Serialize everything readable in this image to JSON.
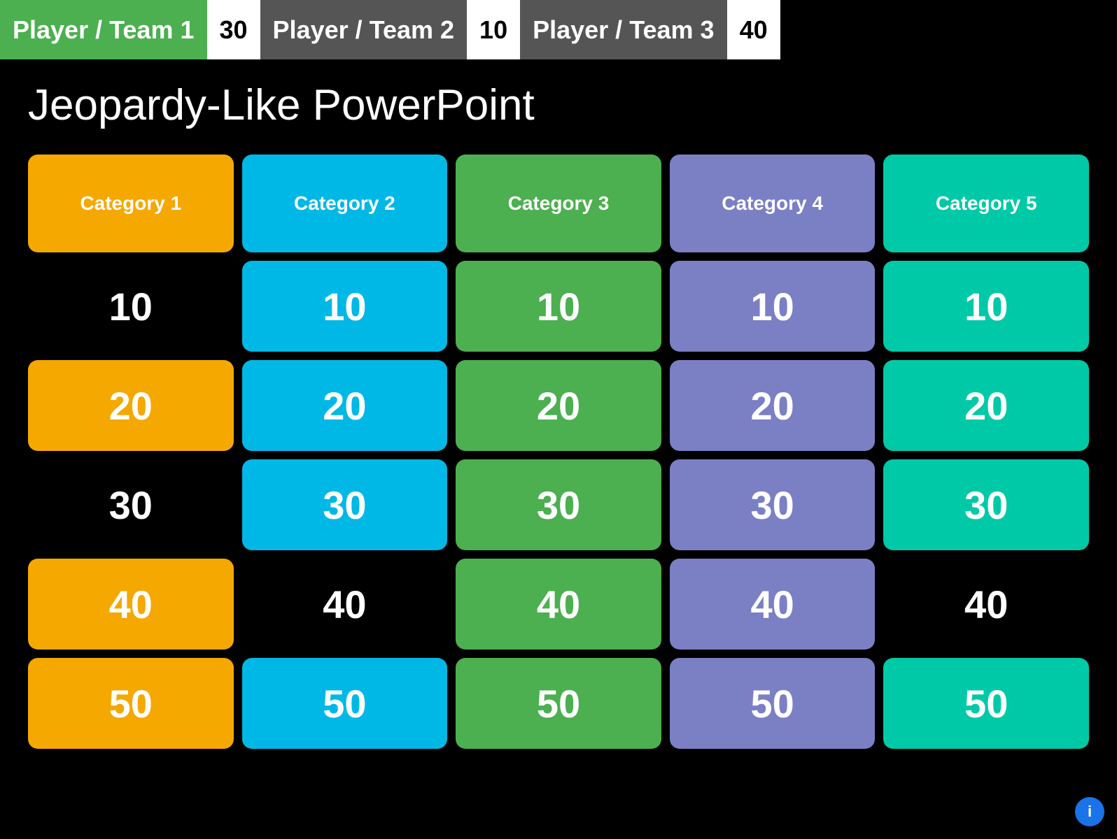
{
  "scorebar": {
    "teams": [
      {
        "name": "Player / Team 1",
        "score": "30",
        "nameClass": "team-1-name"
      },
      {
        "name": "Player / Team 2",
        "score": "10",
        "nameClass": "team-2-name"
      },
      {
        "name": "Player / Team 3",
        "score": "40",
        "nameClass": "team-3-name"
      }
    ]
  },
  "title": "Jeopardy-Like PowerPoint",
  "categories": [
    {
      "label": "Category 1",
      "colorClass": "cat-1",
      "colClass": "col-1"
    },
    {
      "label": "Category 2",
      "colorClass": "cat-2",
      "colClass": "col-2"
    },
    {
      "label": "Category 3",
      "colorClass": "cat-3",
      "colClass": "col-3"
    },
    {
      "label": "Category 4",
      "colorClass": "cat-4",
      "colClass": "col-4"
    },
    {
      "label": "Category 5",
      "colorClass": "cat-5",
      "colClass": "col-5"
    }
  ],
  "values": [
    "10",
    "20",
    "30",
    "40",
    "50"
  ],
  "usedCells": {
    "row0col0": true,
    "row2col0": true,
    "row3col1": true,
    "row3col4": true
  }
}
